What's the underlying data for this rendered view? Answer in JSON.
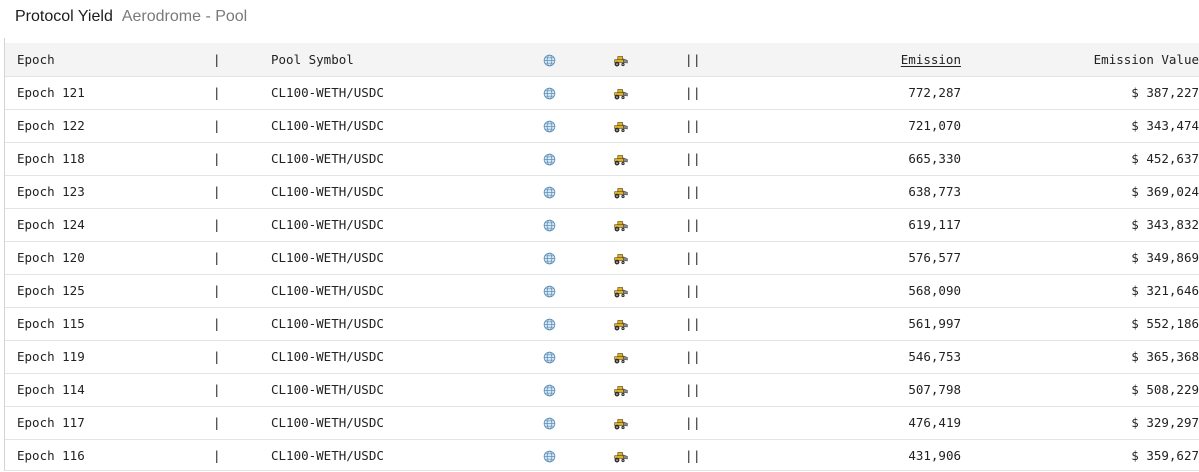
{
  "header": {
    "title": "Protocol Yield",
    "subtitle": "Aerodrome - Pool"
  },
  "table": {
    "columns": {
      "epoch": "Epoch",
      "sep1": "|",
      "pool": "Pool Symbol",
      "sep2": "||",
      "emission": "Emission",
      "value": "Emission Value"
    },
    "icons": {
      "globe": "globe-icon",
      "tractor": "tractor-icon"
    },
    "rows": [
      {
        "epoch": "Epoch 121",
        "sep1": "|",
        "pool": "CL100-WETH/USDC",
        "sep2": "||",
        "emission": "772,287",
        "value": "$ 387,227"
      },
      {
        "epoch": "Epoch 122",
        "sep1": "|",
        "pool": "CL100-WETH/USDC",
        "sep2": "||",
        "emission": "721,070",
        "value": "$ 343,474"
      },
      {
        "epoch": "Epoch 118",
        "sep1": "|",
        "pool": "CL100-WETH/USDC",
        "sep2": "||",
        "emission": "665,330",
        "value": "$ 452,637"
      },
      {
        "epoch": "Epoch 123",
        "sep1": "|",
        "pool": "CL100-WETH/USDC",
        "sep2": "||",
        "emission": "638,773",
        "value": "$ 369,024"
      },
      {
        "epoch": "Epoch 124",
        "sep1": "|",
        "pool": "CL100-WETH/USDC",
        "sep2": "||",
        "emission": "619,117",
        "value": "$ 343,832"
      },
      {
        "epoch": "Epoch 120",
        "sep1": "|",
        "pool": "CL100-WETH/USDC",
        "sep2": "||",
        "emission": "576,577",
        "value": "$ 349,869"
      },
      {
        "epoch": "Epoch 125",
        "sep1": "|",
        "pool": "CL100-WETH/USDC",
        "sep2": "||",
        "emission": "568,090",
        "value": "$ 321,646"
      },
      {
        "epoch": "Epoch 115",
        "sep1": "|",
        "pool": "CL100-WETH/USDC",
        "sep2": "||",
        "emission": "561,997",
        "value": "$ 552,186"
      },
      {
        "epoch": "Epoch 119",
        "sep1": "|",
        "pool": "CL100-WETH/USDC",
        "sep2": "||",
        "emission": "546,753",
        "value": "$ 365,368"
      },
      {
        "epoch": "Epoch 114",
        "sep1": "|",
        "pool": "CL100-WETH/USDC",
        "sep2": "||",
        "emission": "507,798",
        "value": "$ 508,229"
      },
      {
        "epoch": "Epoch 117",
        "sep1": "|",
        "pool": "CL100-WETH/USDC",
        "sep2": "||",
        "emission": "476,419",
        "value": "$ 329,297"
      },
      {
        "epoch": "Epoch 116",
        "sep1": "|",
        "pool": "CL100-WETH/USDC",
        "sep2": "||",
        "emission": "431,906",
        "value": "$ 359,627"
      }
    ]
  }
}
